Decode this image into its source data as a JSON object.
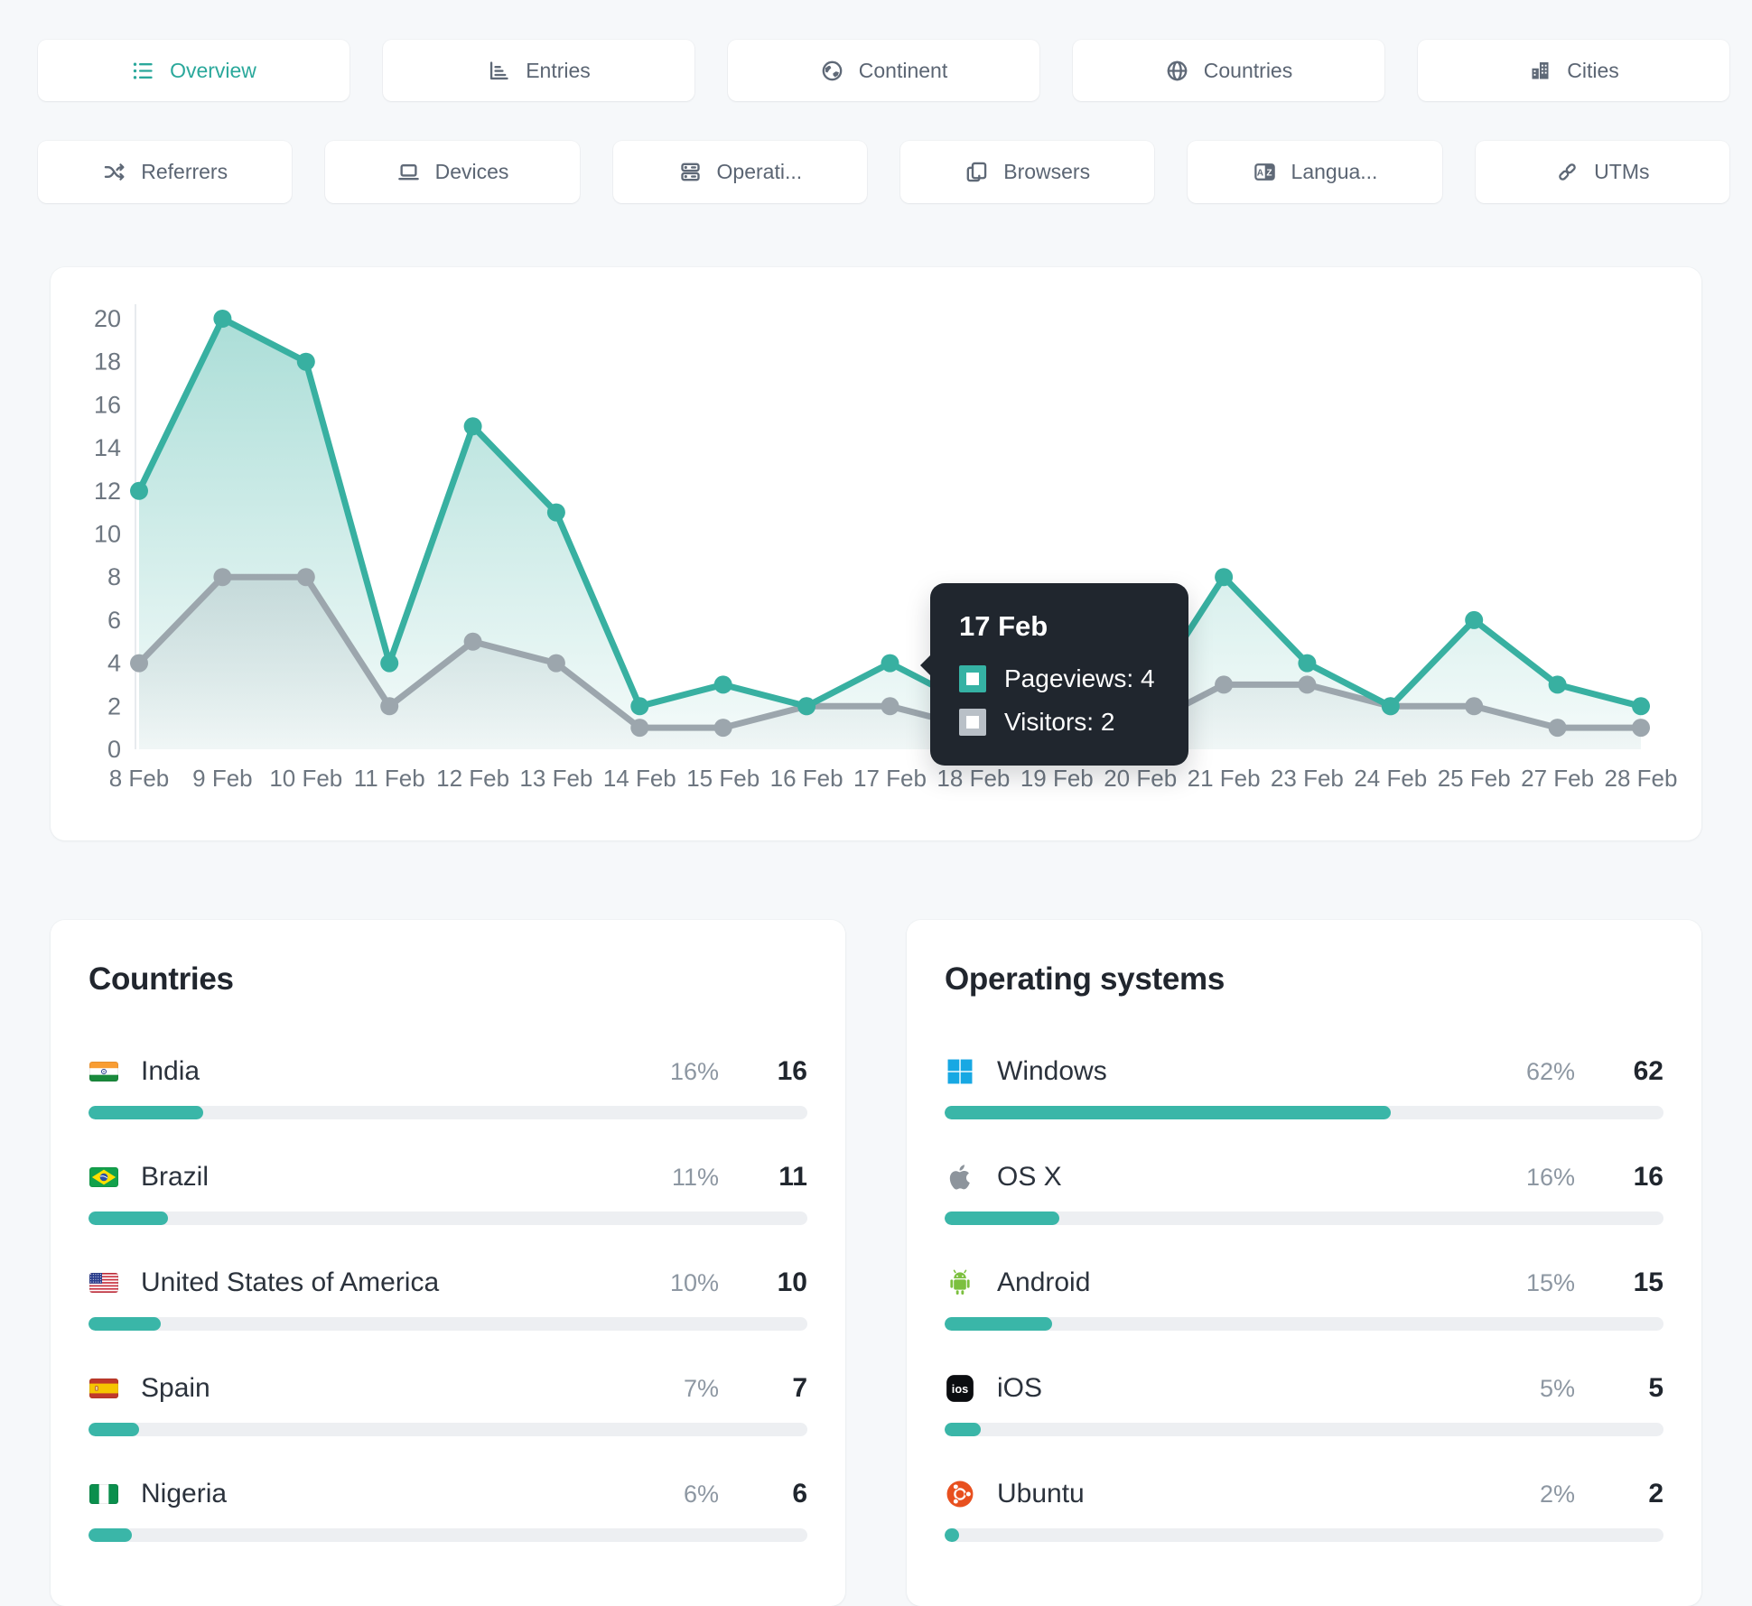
{
  "colors": {
    "accent": "#2aa89b",
    "pageviews_line": "#38b0a1",
    "visitors_line": "#9ca6ad",
    "tooltip_bg": "#20262e",
    "tooltip_visitors_swatch": "#b9c0c7",
    "bar_fill": "#3ab6a8",
    "tab_icon_gray": "#5f6977",
    "windows_blue": "#17a8e3",
    "android_green": "#7cc03f",
    "ubuntu_orange": "#e8501f",
    "apple_gray": "#8d949c"
  },
  "tabs_primary": [
    {
      "label": "Overview",
      "icon": "list",
      "active": true
    },
    {
      "label": "Entries",
      "icon": "entries",
      "active": false
    },
    {
      "label": "Continent",
      "icon": "continent",
      "active": false
    },
    {
      "label": "Countries",
      "icon": "globe",
      "active": false
    },
    {
      "label": "Cities",
      "icon": "city",
      "active": false
    }
  ],
  "tabs_secondary": [
    {
      "label": "Referrers",
      "icon": "shuffle"
    },
    {
      "label": "Devices",
      "icon": "laptop"
    },
    {
      "label": "Operati...",
      "icon": "server"
    },
    {
      "label": "Browsers",
      "icon": "browser"
    },
    {
      "label": "Langua...",
      "icon": "translate"
    },
    {
      "label": "UTMs",
      "icon": "link"
    }
  ],
  "chart_data": {
    "type": "line",
    "x_labels": [
      "8 Feb",
      "9 Feb",
      "10 Feb",
      "11 Feb",
      "12 Feb",
      "13 Feb",
      "14 Feb",
      "15 Feb",
      "16 Feb",
      "17 Feb",
      "18 Feb",
      "19 Feb",
      "20 Feb",
      "21 Feb",
      "23 Feb",
      "24 Feb",
      "25 Feb",
      "27 Feb",
      "28 Feb"
    ],
    "ylim": [
      0,
      20
    ],
    "y_ticks": [
      0,
      2,
      4,
      6,
      8,
      10,
      12,
      14,
      16,
      18,
      20
    ],
    "grid": false,
    "legend": "none",
    "series": [
      {
        "name": "Pageviews",
        "color": "#38b0a1",
        "values": [
          12,
          20,
          18,
          4,
          15,
          11,
          2,
          3,
          2,
          4,
          2,
          1,
          2,
          8,
          4,
          2,
          6,
          3,
          2
        ]
      },
      {
        "name": "Visitors",
        "color": "#9ca6ad",
        "values": [
          4,
          8,
          8,
          2,
          5,
          4,
          1,
          1,
          2,
          2,
          1,
          1,
          1,
          3,
          3,
          2,
          2,
          1,
          1
        ]
      }
    ]
  },
  "tooltip": {
    "title": "17 Feb",
    "items": [
      {
        "label": "Pageviews",
        "value": "4",
        "swatch": "#35b2a4"
      },
      {
        "label": "Visitors",
        "value": "2",
        "swatch": "#b9c0c7"
      }
    ]
  },
  "panels": [
    {
      "title": "Countries",
      "rows": [
        {
          "icon": "flag-india",
          "label": "India",
          "percent": "16%",
          "count": "16",
          "bar_pct": 16
        },
        {
          "icon": "flag-brazil",
          "label": "Brazil",
          "percent": "11%",
          "count": "11",
          "bar_pct": 11
        },
        {
          "icon": "flag-usa",
          "label": "United States of America",
          "percent": "10%",
          "count": "10",
          "bar_pct": 10
        },
        {
          "icon": "flag-spain",
          "label": "Spain",
          "percent": "7%",
          "count": "7",
          "bar_pct": 7
        },
        {
          "icon": "flag-nigeria",
          "label": "Nigeria",
          "percent": "6%",
          "count": "6",
          "bar_pct": 6
        }
      ]
    },
    {
      "title": "Operating systems",
      "rows": [
        {
          "icon": "windows",
          "label": "Windows",
          "percent": "62%",
          "count": "62",
          "bar_pct": 62
        },
        {
          "icon": "apple",
          "label": "OS X",
          "percent": "16%",
          "count": "16",
          "bar_pct": 16
        },
        {
          "icon": "android",
          "label": "Android",
          "percent": "15%",
          "count": "15",
          "bar_pct": 15
        },
        {
          "icon": "ios",
          "label": "iOS",
          "percent": "5%",
          "count": "5",
          "bar_pct": 5
        },
        {
          "icon": "ubuntu",
          "label": "Ubuntu",
          "percent": "2%",
          "count": "2",
          "bar_pct": 2
        }
      ]
    }
  ],
  "ios_badge_text": "ios"
}
